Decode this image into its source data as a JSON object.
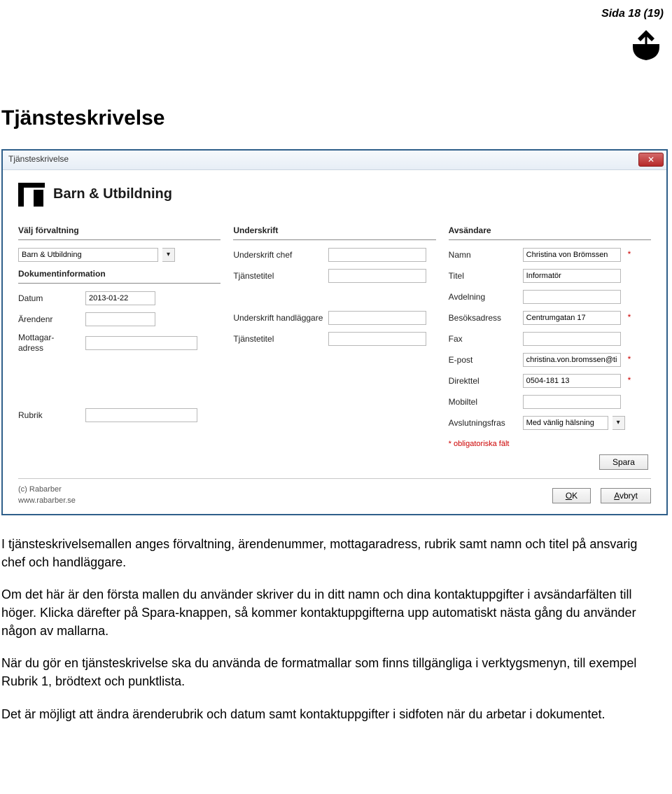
{
  "page_label": "Sida 18 (19)",
  "doc_title": "Tjänsteskrivelse",
  "window_title": "Tjänsteskrivelse",
  "brand_title": "Barn & Utbildning",
  "col1": {
    "section1": "Välj förvaltning",
    "forvaltning_value": "Barn & Utbildning",
    "section2": "Dokumentinformation",
    "datum_label": "Datum",
    "datum_value": "2013-01-22",
    "arendenr_label": "Ärendenr",
    "mottagar_label": "Mottagar-\nadress",
    "rubrik_label": "Rubrik"
  },
  "col2": {
    "section": "Underskrift",
    "chef_label": "Underskrift chef",
    "titel1_label": "Tjänstetitel",
    "handlaggare_label": "Underskrift handläggare",
    "titel2_label": "Tjänstetitel"
  },
  "col3": {
    "section": "Avsändare",
    "namn_label": "Namn",
    "namn_value": "Christina von Brömssen",
    "titel_label": "Titel",
    "titel_value": "Informatör",
    "avdelning_label": "Avdelning",
    "besok_label": "Besöksadress",
    "besok_value": "Centrumgatan 17",
    "fax_label": "Fax",
    "epost_label": "E-post",
    "epost_value": "christina.von.bromssen@tibro.se",
    "direkttel_label": "Direkttel",
    "direkttel_value": "0504-181 13",
    "mobiltel_label": "Mobiltel",
    "avslut_label": "Avslutningsfras",
    "avslut_value": "Med vänlig hälsning",
    "oblig": "* obligatoriska fält",
    "spara": "Spara"
  },
  "footer_credit_1": "(c) Rabarber",
  "footer_credit_2": "www.rabarber.se",
  "btn_ok": "OK",
  "btn_cancel": "Avbryt",
  "para1": "I tjänsteskrivelsemallen anges förvaltning, ärendenummer, mottagaradress, rubrik samt namn och titel på ansvarig chef och handläggare.",
  "para2": "Om det här är den första mallen du använder skriver du in ditt namn och dina kontaktuppgifter i avsändarfälten till höger. Klicka därefter på Spara-knappen, så kommer kontaktuppgifterna upp automatiskt nästa gång du använder någon av mallarna.",
  "para3": "När du gör en tjänsteskrivelse ska du använda de formatmallar som finns tillgängliga i verktygsmenyn, till exempel Rubrik 1, brödtext och punktlista.",
  "para4": "Det är möjligt att ändra ärenderubrik och datum samt kontaktuppgifter i sidfoten när du arbetar i dokumentet."
}
